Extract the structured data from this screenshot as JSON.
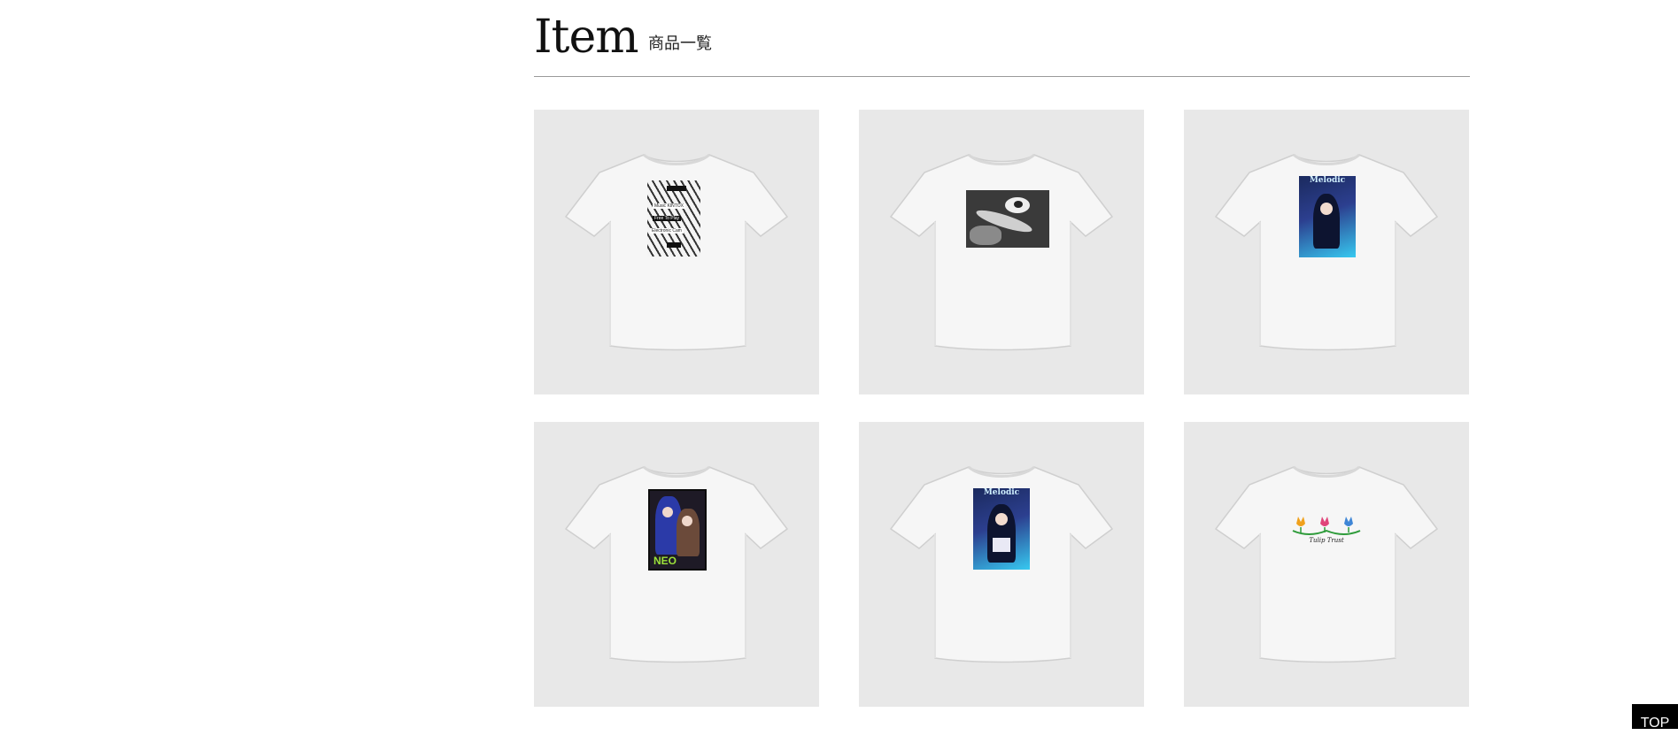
{
  "header": {
    "title": "Item",
    "subtitle": "商品一覧"
  },
  "items": [
    {
      "name": "tshirt-product-1",
      "print": "striped-text-design",
      "print_lines": [
        "",
        "Music KINTOX",
        "Free To Play",
        "Electronic Cam",
        ""
      ]
    },
    {
      "name": "tshirt-product-2",
      "print": "monochrome-art-design"
    },
    {
      "name": "tshirt-product-3",
      "print": "anime-character-melodic-design",
      "print_text": "Melodic"
    },
    {
      "name": "tshirt-product-4",
      "print": "anime-character-neo-design",
      "print_text": "NEO"
    },
    {
      "name": "tshirt-product-5",
      "print": "anime-character-melodic-design",
      "print_text": "Melodic"
    },
    {
      "name": "tshirt-product-6",
      "print": "tulip-logo-design",
      "print_text": "Tulip Trust"
    }
  ],
  "footer": {
    "top_button_label": "TOP"
  },
  "colors": {
    "tile_background": "#e8e8e8",
    "divider": "#9a9a9a",
    "top_button": "#000000"
  }
}
